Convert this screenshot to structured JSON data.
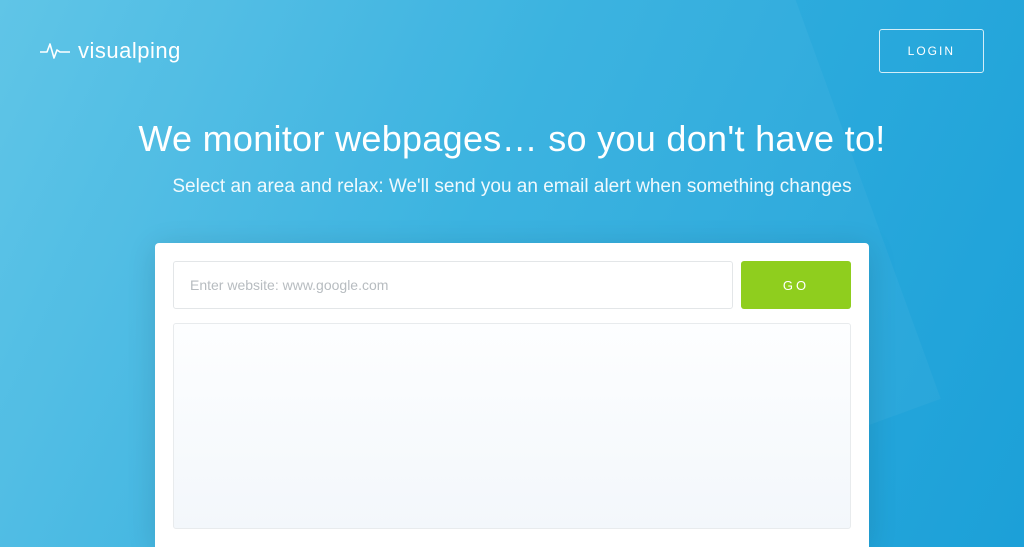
{
  "brand": {
    "name": "visualping",
    "icon": "pulse-icon"
  },
  "header": {
    "login_label": "LOGIN"
  },
  "hero": {
    "headline": "We monitor webpages… so you don't have to!",
    "subhead": "Select an area and relax: We'll send you an email alert when something changes"
  },
  "form": {
    "url_placeholder": "Enter website: www.google.com",
    "go_label": "GO"
  },
  "colors": {
    "accent_green": "#8fce1e",
    "bg_blue_light": "#5ac3e6",
    "bg_blue_dark": "#1ca0d8"
  }
}
